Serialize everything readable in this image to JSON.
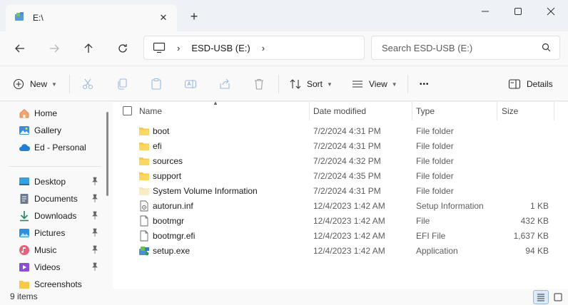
{
  "tab": {
    "title": "E:\\",
    "close_glyph": "✕",
    "new_glyph": "+"
  },
  "window_controls": {
    "minimize": "—",
    "maximize": "☐",
    "close": "✕"
  },
  "address": {
    "segment": "ESD-USB (E:)",
    "separator": "›"
  },
  "search": {
    "placeholder": "Search ESD-USB (E:)"
  },
  "toolbar": {
    "new_label": "New",
    "sort_label": "Sort",
    "view_label": "View",
    "more_label": "•••",
    "details_label": "Details"
  },
  "sidebar": {
    "groups": [
      [
        {
          "label": "Home",
          "icon": "home-icon"
        },
        {
          "label": "Gallery",
          "icon": "gallery-icon"
        },
        {
          "label": "Ed - Personal",
          "icon": "onedrive-icon"
        }
      ],
      [
        {
          "label": "Desktop",
          "icon": "desktop-icon",
          "pinned": true
        },
        {
          "label": "Documents",
          "icon": "documents-icon",
          "pinned": true
        },
        {
          "label": "Downloads",
          "icon": "downloads-icon",
          "pinned": true
        },
        {
          "label": "Pictures",
          "icon": "pictures-icon",
          "pinned": true
        },
        {
          "label": "Music",
          "icon": "music-icon",
          "pinned": true
        },
        {
          "label": "Videos",
          "icon": "videos-icon",
          "pinned": true
        },
        {
          "label": "Screenshots",
          "icon": "folder-icon",
          "pinned": false
        }
      ]
    ]
  },
  "columns": {
    "name": "Name",
    "date": "Date modified",
    "type": "Type",
    "size": "Size"
  },
  "files": [
    {
      "name": "boot",
      "date": "7/2/2024 4:31 PM",
      "type": "File folder",
      "size": "",
      "icon": "folder-icon"
    },
    {
      "name": "efi",
      "date": "7/2/2024 4:31 PM",
      "type": "File folder",
      "size": "",
      "icon": "folder-icon"
    },
    {
      "name": "sources",
      "date": "7/2/2024 4:32 PM",
      "type": "File folder",
      "size": "",
      "icon": "folder-icon"
    },
    {
      "name": "support",
      "date": "7/2/2024 4:35 PM",
      "type": "File folder",
      "size": "",
      "icon": "folder-icon"
    },
    {
      "name": "System Volume Information",
      "date": "7/2/2024 4:31 PM",
      "type": "File folder",
      "size": "",
      "icon": "system-folder-icon"
    },
    {
      "name": "autorun.inf",
      "date": "12/4/2023 1:42 AM",
      "type": "Setup Information",
      "size": "1 KB",
      "icon": "setup-info-icon"
    },
    {
      "name": "bootmgr",
      "date": "12/4/2023 1:42 AM",
      "type": "File",
      "size": "432 KB",
      "icon": "file-icon"
    },
    {
      "name": "bootmgr.efi",
      "date": "12/4/2023 1:42 AM",
      "type": "EFI File",
      "size": "1,637 KB",
      "icon": "file-icon"
    },
    {
      "name": "setup.exe",
      "date": "12/4/2023 1:42 AM",
      "type": "Application",
      "size": "94 KB",
      "icon": "setup-exe-icon"
    }
  ],
  "status": {
    "count": "9 items"
  },
  "colors": {
    "folder": "#f8c948",
    "accent": "#0f6cbd",
    "background": "#eef1f6"
  }
}
